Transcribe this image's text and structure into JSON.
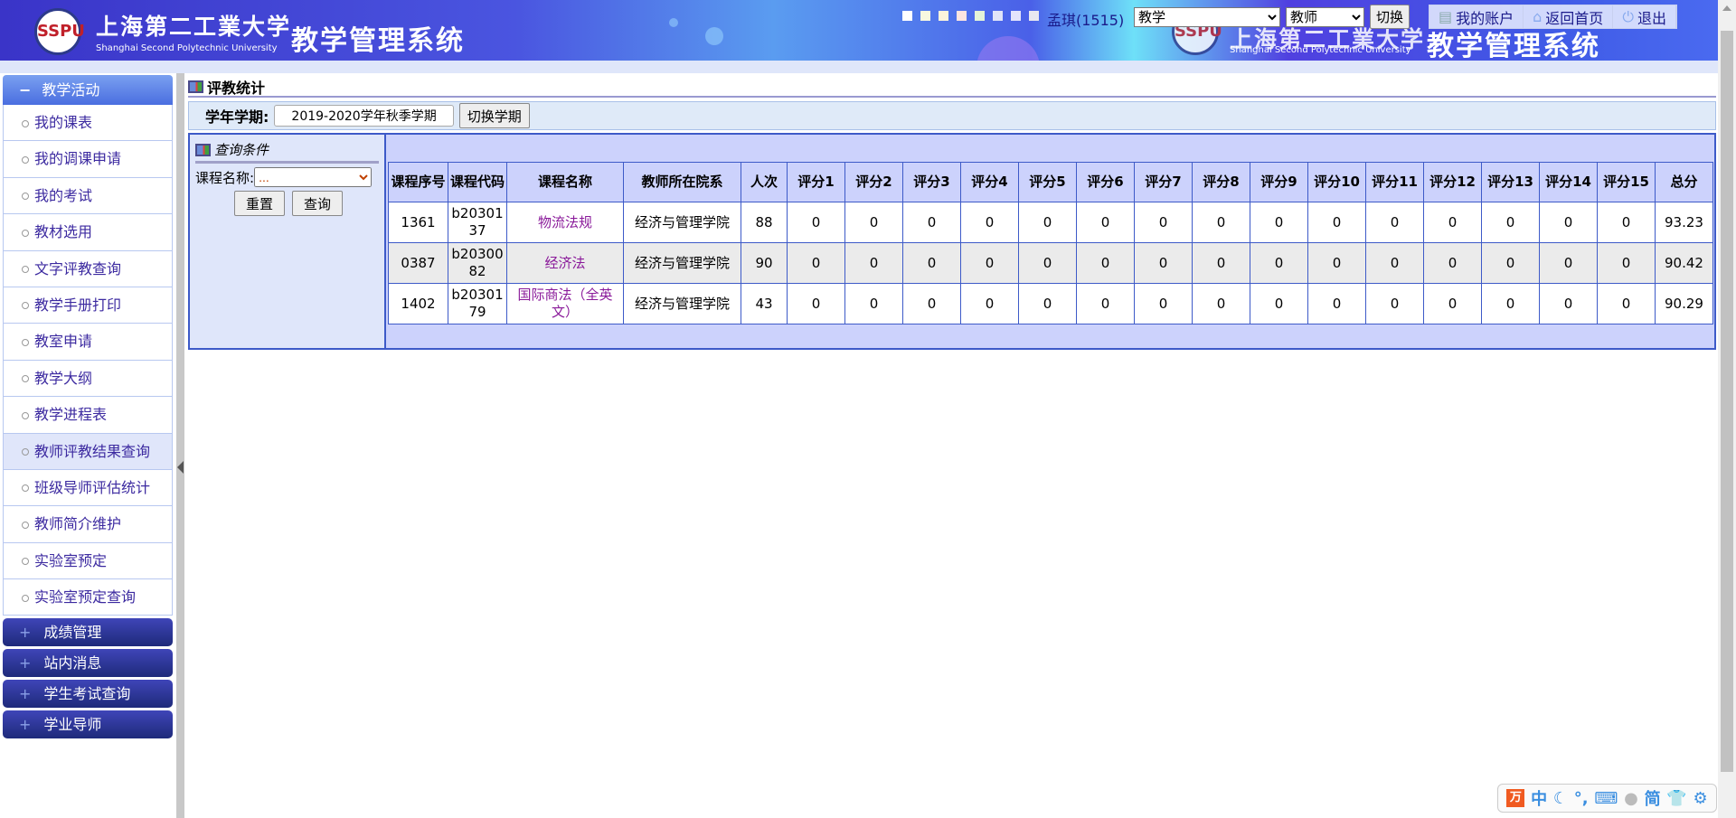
{
  "header": {
    "university_cn": "上海第二工業大学",
    "university_en": "Shanghai Second Polytechnic University",
    "system_title": "教学管理系统",
    "logo_text": "SSPU",
    "user": "孟琪(1515)",
    "role_select": "教学",
    "identity_select": "教师",
    "switch_button": "切换",
    "nav": [
      {
        "label": "我的账户",
        "icon": "account-icon"
      },
      {
        "label": "返回首页",
        "icon": "home-icon"
      },
      {
        "label": "退出",
        "icon": "power-icon"
      }
    ],
    "swatches": [
      "#ffffff",
      "#f8f8e0",
      "#fcf4dc",
      "#fce4e0",
      "#e4f4d8",
      "#e0e4f8",
      "#e4e4fc",
      "#e8e8f0"
    ]
  },
  "sidebar": {
    "open_group": "教学活动",
    "items": [
      "我的课表",
      "我的调课申请",
      "我的考试",
      "教材选用",
      "文字评教查询",
      "教学手册打印",
      "教室申请",
      "教学大纲",
      "教学进程表",
      "教师评教结果查询",
      "班级导师评估统计",
      "教师简介维护",
      "实验室预定",
      "实验室预定查询"
    ],
    "active_index": 9,
    "groups": [
      "成绩管理",
      "站内消息",
      "学生考试查询",
      "学业导师"
    ]
  },
  "page": {
    "title": "评教统计",
    "term_label": "学年学期:",
    "term_value": "2019-2020学年秋季学期",
    "switch_term": "切换学期",
    "query_title": "查询条件",
    "course_name_label": "课程名称:",
    "course_name_value": "...",
    "reset": "重置",
    "query": "查询"
  },
  "table": {
    "headers": [
      "课程序号",
      "课程代码",
      "课程名称",
      "教师所在院系",
      "人次",
      "评分1",
      "评分2",
      "评分3",
      "评分4",
      "评分5",
      "评分6",
      "评分7",
      "评分8",
      "评分9",
      "评分10",
      "评分11",
      "评分12",
      "评分13",
      "评分14",
      "评分15",
      "总分"
    ],
    "rows": [
      [
        "1361",
        "b2030137",
        "物流法规",
        "经济与管理学院",
        "88",
        "0",
        "0",
        "0",
        "0",
        "0",
        "0",
        "0",
        "0",
        "0",
        "0",
        "0",
        "0",
        "0",
        "0",
        "0",
        "93.23"
      ],
      [
        "0387",
        "b2030082",
        "经济法",
        "经济与管理学院",
        "90",
        "0",
        "0",
        "0",
        "0",
        "0",
        "0",
        "0",
        "0",
        "0",
        "0",
        "0",
        "0",
        "0",
        "0",
        "0",
        "90.42"
      ],
      [
        "1402",
        "b2030179",
        "国际商法（全英文）",
        "经济与管理学院",
        "43",
        "0",
        "0",
        "0",
        "0",
        "0",
        "0",
        "0",
        "0",
        "0",
        "0",
        "0",
        "0",
        "0",
        "0",
        "0",
        "90.29"
      ]
    ]
  },
  "ime": {
    "items": [
      "中",
      "简"
    ]
  }
}
